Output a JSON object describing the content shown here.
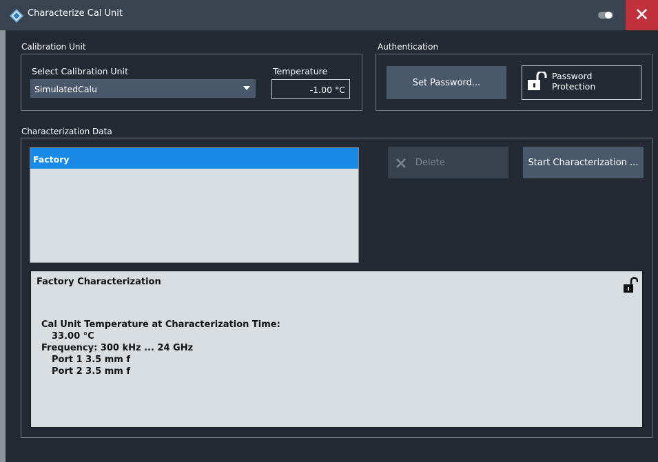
{
  "window": {
    "title": "Characterize Cal Unit",
    "close_symbol": "✕"
  },
  "calibration_unit": {
    "group_label": "Calibration Unit",
    "select_label": "Select Calibration Unit",
    "selected_value": "SimulatedCalu",
    "temperature_label": "Temperature",
    "temperature_value": "-1.00 °C"
  },
  "authentication": {
    "group_label": "Authentication",
    "set_password_label": "Set Password...",
    "password_protection_line1": "Password",
    "password_protection_line2": "Protection"
  },
  "characterization_data": {
    "group_label": "Characterization Data",
    "items": [
      {
        "label": "Factory",
        "selected": true
      }
    ],
    "delete_label": "Delete",
    "start_label": "Start Characterization ..."
  },
  "details": {
    "title": "Factory Characterization",
    "lines": [
      "Cal Unit Temperature at Characterization Time:",
      "33.00 °C",
      "Frequency: 300 kHz ... 24 GHz",
      "Port 1 3.5 mm f",
      "Port 2 3.5 mm f"
    ]
  },
  "colors": {
    "background": "#242a33",
    "titlebar": "#3a4350",
    "close_button": "#c0313c",
    "selection": "#1989e6",
    "button": "#49586b"
  },
  "icons": {
    "app_logo": "rohde-schwarz-logo-icon",
    "toggle": "toggle-icon",
    "lock": "unlocked-padlock-icon",
    "delete": "x-icon"
  }
}
